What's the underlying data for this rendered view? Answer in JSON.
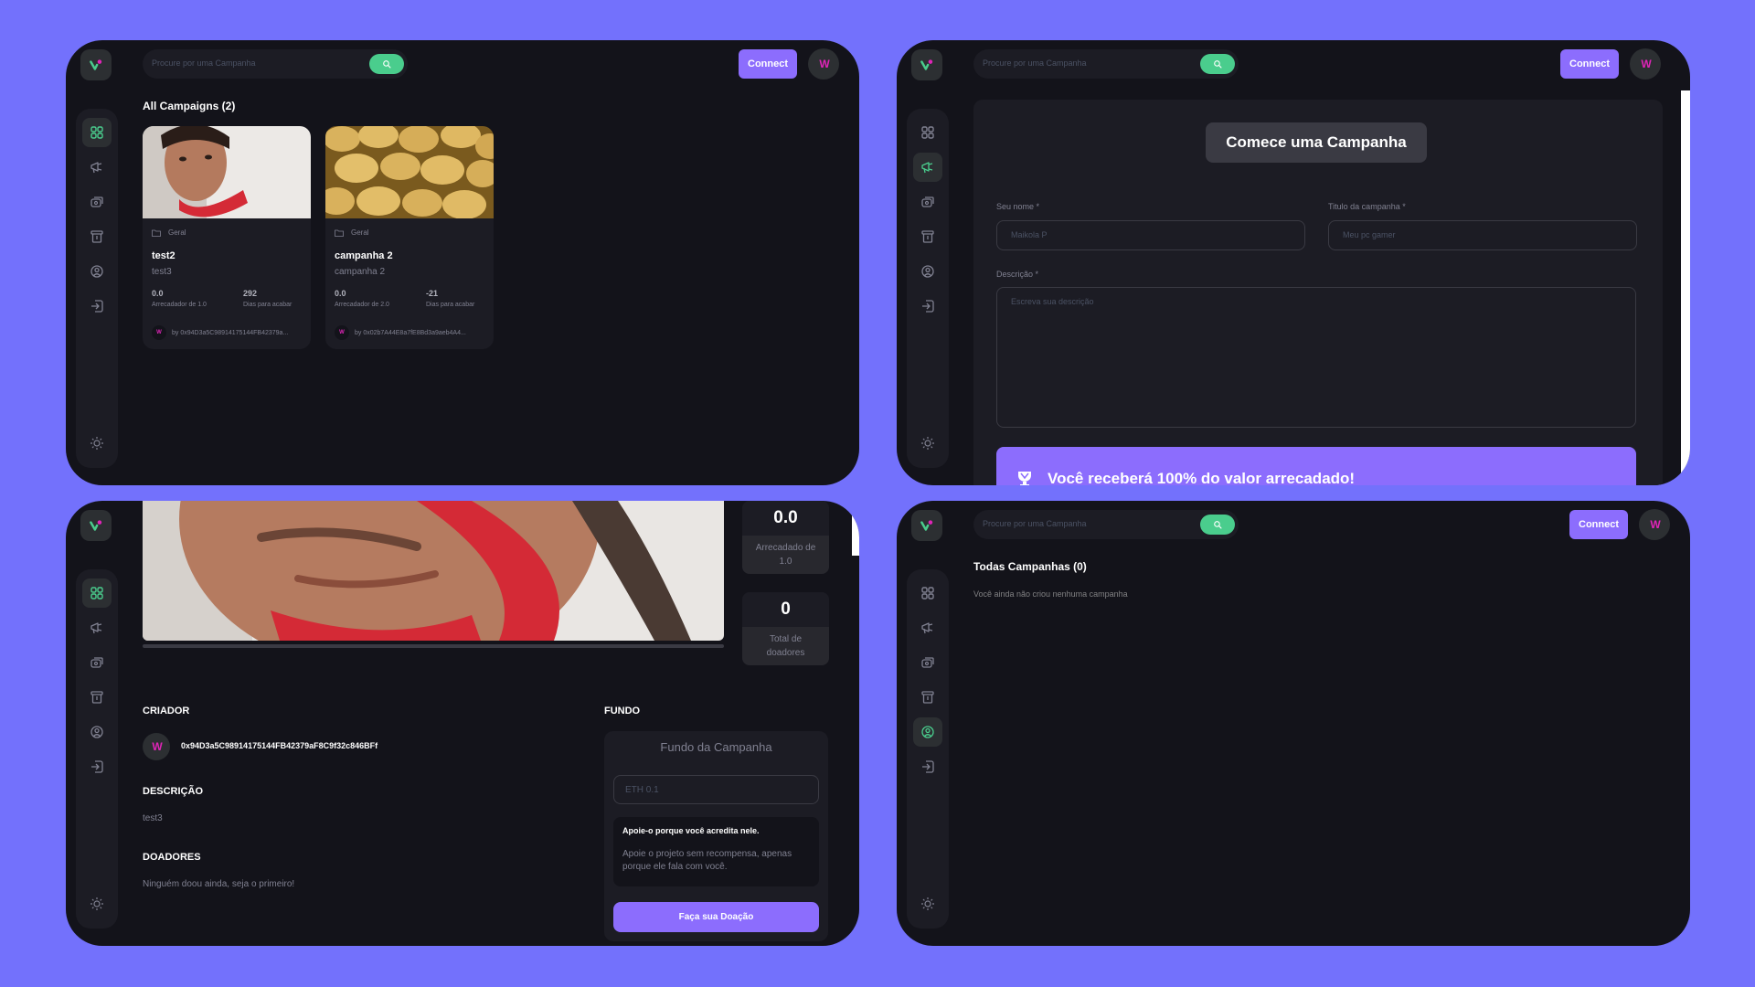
{
  "search": {
    "placeholder": "Procure por uma Campanha"
  },
  "header": {
    "connect_label": "Connect",
    "avatar_text": "W"
  },
  "panel1": {
    "title": "All Campaigns (2)",
    "cards": [
      {
        "category": "Geral",
        "title": "test2",
        "subtitle": "test3",
        "raised": "0.0",
        "raised_label": "Arrecadador de 1.0",
        "days": "292",
        "days_label": "Dias para acabar",
        "owner": "by 0x94D3a5C98914175144FB42379a..."
      },
      {
        "category": "Geral",
        "title": "campanha 2",
        "subtitle": "campanha 2",
        "raised": "0.0",
        "raised_label": "Arrecadador de 2.0",
        "days": "-21",
        "days_label": "Dias para acabar",
        "owner": "by 0x02b7A44E8a7fE8Bd3a9aeb4A4..."
      }
    ]
  },
  "panel2": {
    "header": "Comece uma Campanha",
    "name_label": "Seu nome *",
    "name_placeholder": "Maikola P",
    "title_label": "Titulo da campanha *",
    "title_placeholder": "Meu pc gamer",
    "desc_label": "Descrição *",
    "desc_placeholder": "Escreva sua descrição",
    "banner": "Você receberá 100% do valor arrecadado!"
  },
  "panel3": {
    "raised": "0.0",
    "raised_label": "Arrecadado de 1.0",
    "backers": "0",
    "backers_label": "Total de doadores",
    "creator_heading": "Criador",
    "creator_address": "0x94D3a5C98914175144FB42379aF8C9f32c846BFf",
    "desc_heading": "Descrição",
    "desc_text": "test3",
    "donors_heading": "Doadores",
    "donors_text": "Ninguém doou ainda, seja o primeiro!",
    "fund_heading": "Fundo",
    "fund_title": "Fundo da Campanha",
    "fund_placeholder": "ETH 0.1",
    "note_title": "Apoie-o porque você acredita nele.",
    "note_body": "Apoie o projeto sem recompensa, apenas porque ele fala com você.",
    "donate_label": "Faça sua Doação"
  },
  "panel4": {
    "title": "Todas Campanhas (0)",
    "empty_text": "Você ainda não criou nenhuma campanha"
  },
  "colors": {
    "accent": "#8c6dfd",
    "green": "#4acd8d",
    "background": "#7371fc",
    "panel": "#13131a",
    "card": "#1c1c24"
  },
  "icons": [
    "dashboard-icon",
    "campaign-icon",
    "payment-icon",
    "withdraw-icon",
    "profile-icon",
    "logout-icon",
    "sun-icon",
    "search-icon",
    "folder-icon",
    "trophy-icon"
  ]
}
